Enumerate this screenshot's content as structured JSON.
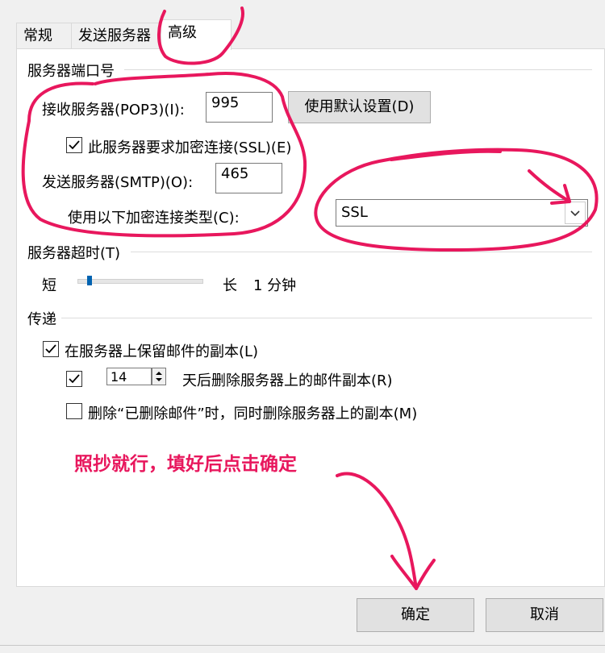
{
  "tabs": [
    {
      "label": "常规",
      "active": false
    },
    {
      "label": "发送服务器",
      "active": false
    },
    {
      "label": "高级",
      "active": true
    }
  ],
  "server_ports": {
    "group_label": "服务器端口号",
    "incoming_label": "接收服务器(POP3)(I):",
    "incoming_value": "995",
    "use_defaults_button": "使用默认设置(D)",
    "ssl_required_label": "此服务器要求加密连接(SSL)(E)",
    "ssl_required_checked": true,
    "outgoing_label": "发送服务器(SMTP)(O):",
    "outgoing_value": "465",
    "encryption_label": "使用以下加密连接类型(C):",
    "encryption_value": "SSL"
  },
  "timeout": {
    "group_label": "服务器超时(T)",
    "short_label": "短",
    "long_label": "长",
    "value_text": "1 分钟",
    "level_fraction": 0.1
  },
  "delivery": {
    "group_label": "传递",
    "keep_copy_label": "在服务器上保留邮件的副本(L)",
    "keep_copy_checked": true,
    "remove_after_checked": true,
    "remove_after_days": "14",
    "remove_after_label": "天后删除服务器上的邮件副本(R)",
    "remove_when_deleted_label": "删除“已删除邮件”时，同时删除服务器上的副本(M)",
    "remove_when_deleted_checked": false
  },
  "annotation": {
    "text": "照抄就行，填好后点击确定",
    "color": "#e8175d"
  },
  "footer": {
    "ok_button": "确定",
    "cancel_button": "取消"
  },
  "icons": {
    "dropdown_arrow": "chevron-down-icon",
    "check": "checkmark-icon",
    "spinner": "spinner-arrows-icon"
  }
}
